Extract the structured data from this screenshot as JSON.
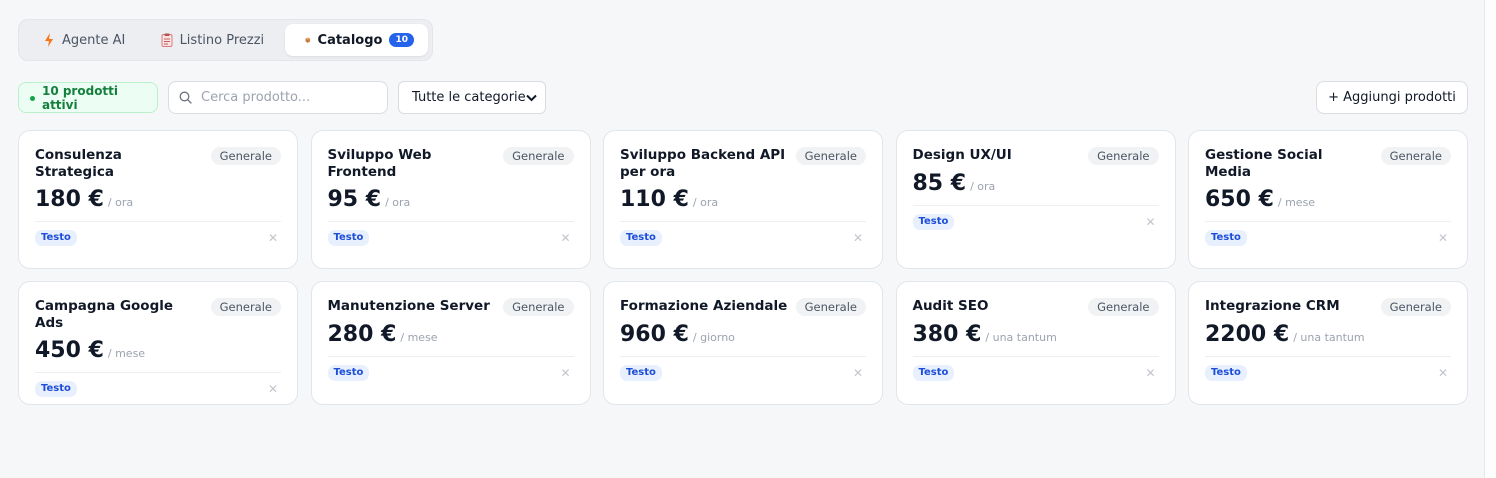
{
  "tabs": [
    {
      "label": "Agente AI",
      "icon": "lightning-icon"
    },
    {
      "label": "Listino Prezzi",
      "icon": "clipboard-icon"
    },
    {
      "label": "Catalogo",
      "icon": "package-icon",
      "count": "10",
      "active": true
    }
  ],
  "toolbar": {
    "active_count": "10 prodotti attivi",
    "search_placeholder": "Cerca prodotto...",
    "category_selected": "Tutte le categorie",
    "add_label": "+ Aggiungi prodotti"
  },
  "colors": {
    "accent": "#2563eb",
    "active_green": "#15803d",
    "tag_blue": "#1d4ed8"
  },
  "products": [
    {
      "name": "Consulenza Strategica",
      "category": "Generale",
      "price": "180 €",
      "unit": "/ ora",
      "tag": "Testo"
    },
    {
      "name": "Sviluppo Web Frontend",
      "category": "Generale",
      "price": "95 €",
      "unit": "/ ora",
      "tag": "Testo"
    },
    {
      "name": "Sviluppo Backend API per ora",
      "category": "Generale",
      "price": "110 €",
      "unit": "/ ora",
      "tag": "Testo"
    },
    {
      "name": "Design UX/UI",
      "category": "Generale",
      "price": "85 €",
      "unit": "/ ora",
      "tag": "Testo"
    },
    {
      "name": "Gestione Social Media",
      "category": "Generale",
      "price": "650 €",
      "unit": "/ mese",
      "tag": "Testo"
    },
    {
      "name": "Campagna Google Ads",
      "category": "Generale",
      "price": "450 €",
      "unit": "/ mese",
      "tag": "Testo"
    },
    {
      "name": "Manutenzione Server",
      "category": "Generale",
      "price": "280 €",
      "unit": "/ mese",
      "tag": "Testo"
    },
    {
      "name": "Formazione Aziendale",
      "category": "Generale",
      "price": "960 €",
      "unit": "/ giorno",
      "tag": "Testo"
    },
    {
      "name": "Audit SEO",
      "category": "Generale",
      "price": "380 €",
      "unit": "/ una tantum",
      "tag": "Testo"
    },
    {
      "name": "Integrazione CRM",
      "category": "Generale",
      "price": "2200 €",
      "unit": "/ una tantum",
      "tag": "Testo"
    }
  ]
}
